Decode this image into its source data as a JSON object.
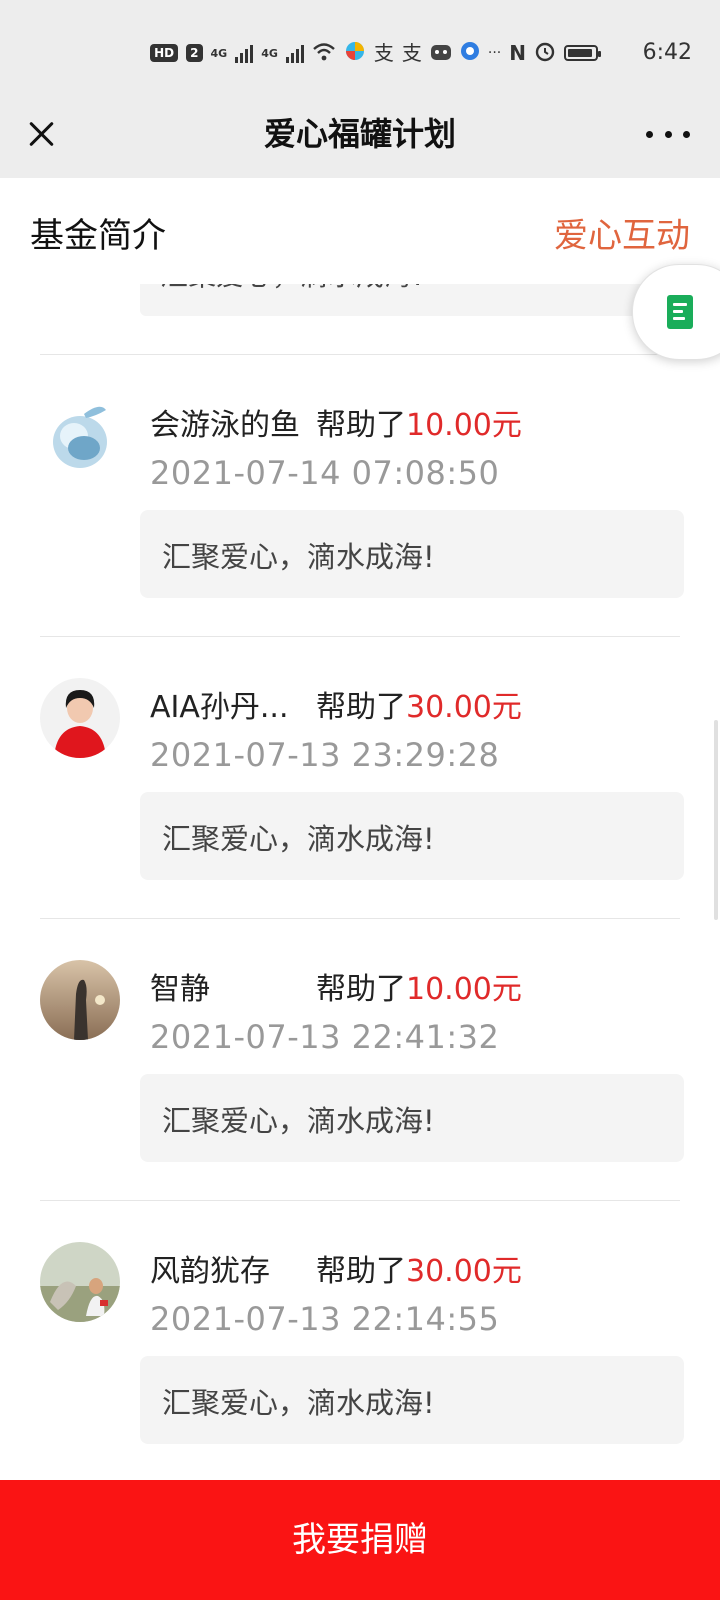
{
  "status_bar": {
    "time": "6:42",
    "hd_badge": "HD",
    "sim_badge": "2",
    "net1": "4G",
    "net2": "4G",
    "more": "···",
    "nfc": "N"
  },
  "header": {
    "title": "爱心福罐计划"
  },
  "tabs": {
    "left": "基金简介",
    "right": "爱心互动"
  },
  "partial_message": "汇聚爱心，滴水成海!",
  "entries": [
    {
      "name": "会游泳的鱼",
      "helped": "帮助了",
      "amount": "10.00元",
      "time": "2021-07-14 07:08:50",
      "message": "汇聚爱心，滴水成海!"
    },
    {
      "name": "AIA孙丹...",
      "helped": "帮助了",
      "amount": "30.00元",
      "time": "2021-07-13 23:29:28",
      "message": "汇聚爱心，滴水成海!"
    },
    {
      "name": "智静",
      "helped": "帮助了",
      "amount": "10.00元",
      "time": "2021-07-13 22:41:32",
      "message": "汇聚爱心，滴水成海!"
    },
    {
      "name": "风韵犹存",
      "helped": "帮助了",
      "amount": "30.00元",
      "time": "2021-07-13 22:14:55",
      "message": "汇聚爱心，滴水成海!"
    }
  ],
  "donate_button": "我要捐赠",
  "colors": {
    "accent_orange": "#e0653e",
    "amount_red": "#e02a2a",
    "button_red": "#fa1414"
  }
}
